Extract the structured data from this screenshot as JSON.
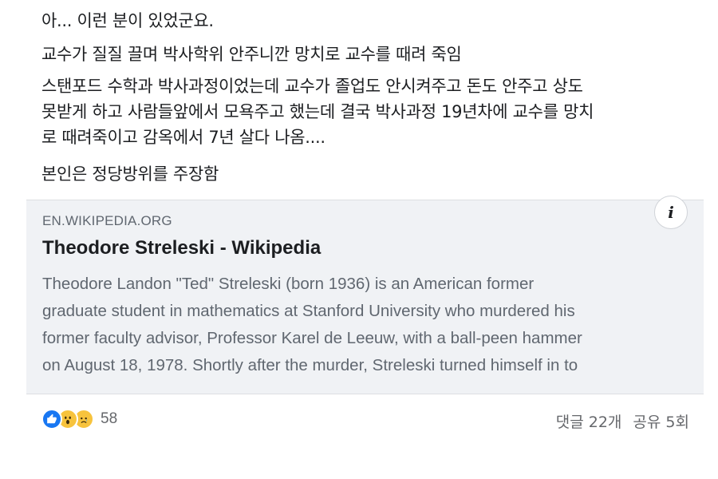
{
  "post": {
    "p1": "아... 이런 분이 있었군요.",
    "p2": "교수가 질질 끌며 박사학위 안주니깐 망치로 교수를 때려 죽임",
    "p3_lines": [
      "스탠포드 수학과 박사과정이었는데 교수가 졸업도 안시켜주고 돈도 안주고 상도",
      "못받게 하고 사람들앞에서 모욕주고 했는데 결국 박사과정 19년차에 교수를 망치",
      "로 때려죽이고 감옥에서 7년 살다 나옴...."
    ],
    "p4": "본인은 정당방위를 주장함"
  },
  "link_card": {
    "domain": "EN.WIKIPEDIA.ORG",
    "title": "Theodore Streleski - Wikipedia",
    "description_lines": [
      "Theodore Landon \"Ted\" Streleski (born 1936) is an American former",
      "graduate student in mathematics at Stanford University who murdered his",
      "former faculty advisor, Professor Karel de Leeuw, with a ball-peen hammer",
      "on August 18, 1978. Shortly after the murder, Streleski turned himself in to"
    ],
    "info_icon": "i"
  },
  "footer": {
    "reaction_icons": [
      "like-icon",
      "wow-icon",
      "sad-icon"
    ],
    "reaction_count": "58",
    "comments": "댓글 22개",
    "shares": "공유 5회"
  },
  "colors": {
    "like": "#1877f2",
    "emoji": "#f7c33d",
    "card_bg": "#f0f2f5",
    "muted_text": "#606770"
  }
}
